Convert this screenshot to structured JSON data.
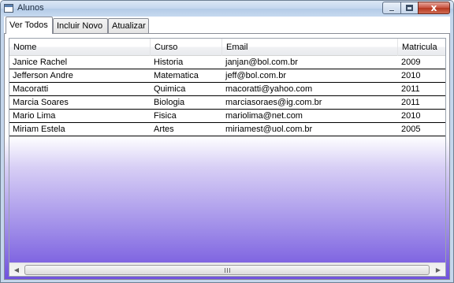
{
  "window": {
    "title": "Alunos",
    "close_glyph": "x"
  },
  "tabs": [
    {
      "label": "Ver Todos",
      "selected": true
    },
    {
      "label": "Incluir Novo",
      "selected": false
    },
    {
      "label": "Atualizar",
      "selected": false
    }
  ],
  "grid": {
    "columns": [
      "Nome",
      "Curso",
      "Email",
      "Matricula"
    ],
    "rows": [
      {
        "nome": "Janice Rachel",
        "curso": "Historia",
        "email": "janjan@bol.com.br",
        "matricula": "2009"
      },
      {
        "nome": "Jefferson Andre",
        "curso": "Matematica",
        "email": "jeff@bol.com.br",
        "matricula": "2010"
      },
      {
        "nome": "Macoratti",
        "curso": "Quimica",
        "email": "macoratti@yahoo.com",
        "matricula": "2011"
      },
      {
        "nome": "Marcia Soares",
        "curso": "Biologia",
        "email": "marciasoraes@ig.com.br",
        "matricula": "2011"
      },
      {
        "nome": "Mario Lima",
        "curso": "Fisica",
        "email": "mariolima@net.com",
        "matricula": "2010"
      },
      {
        "nome": "Miriam Estela",
        "curso": "Artes",
        "email": "miriamest@uol.com.br",
        "matricula": "2005"
      }
    ]
  },
  "scrollbar": {
    "left_arrow_glyph": "◀",
    "right_arrow_glyph": "▶"
  },
  "icons": {
    "app": "window-app-icon",
    "minimize": "minimize-icon",
    "maximize": "maximize-icon",
    "close": "close-icon"
  },
  "colors": {
    "gradient_bottom": "#6f50dd",
    "close_button": "#c7523f"
  }
}
